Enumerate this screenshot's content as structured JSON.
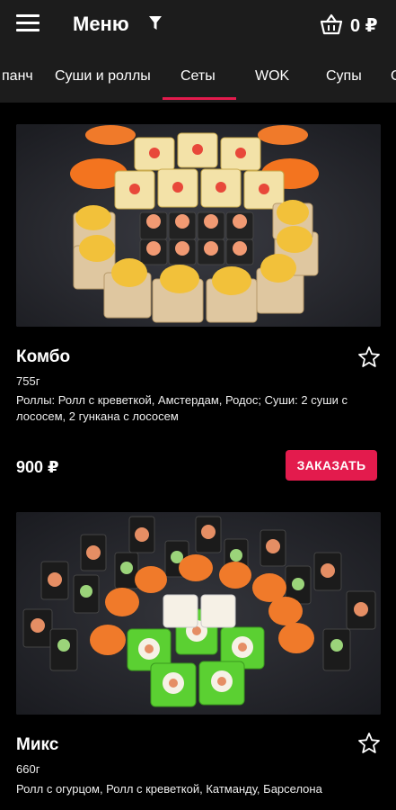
{
  "header": {
    "title": "Меню",
    "cart_count": "0 ₽"
  },
  "tabs": [
    {
      "label": "панч"
    },
    {
      "label": "Суши и роллы"
    },
    {
      "label": "Сеты",
      "active": true
    },
    {
      "label": "WOK"
    },
    {
      "label": "Супы"
    },
    {
      "label": "С"
    }
  ],
  "colors": {
    "accent": "#e31b4d",
    "bar_background": "#1c1c1c",
    "page_background": "#000000"
  },
  "products": [
    {
      "name": "Комбо",
      "weight": "755г",
      "description": "Роллы: Ролл с креветкой, Амстердам, Родос; Суши: 2 суши с лососем, 2 гункана с лососем",
      "price": "900 ₽",
      "order_label": "ЗАКАЗАТЬ"
    },
    {
      "name": "Микс",
      "weight": "660г",
      "description": "Ролл с огурцом, Ролл с креветкой, Катманду, Барселона"
    }
  ]
}
